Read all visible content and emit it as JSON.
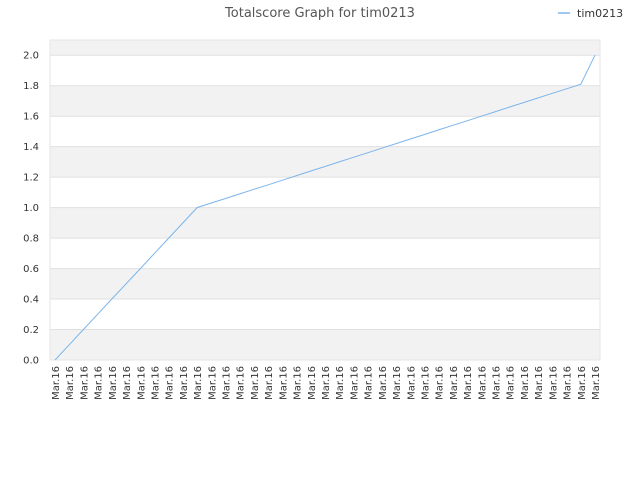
{
  "chart_data": {
    "type": "line",
    "title": "Totalscore Graph for tim0213",
    "xlabel": "",
    "ylabel": "",
    "ylim": [
      0,
      2.1
    ],
    "yticks": [
      "0.0",
      "0.2",
      "0.4",
      "0.6",
      "0.8",
      "1.0",
      "1.2",
      "1.4",
      "1.6",
      "1.8",
      "2.0"
    ],
    "categories": [
      "Mar.16",
      "Mar.16",
      "Mar.16",
      "Mar.16",
      "Mar.16",
      "Mar.16",
      "Mar.16",
      "Mar.16",
      "Mar.16",
      "Mar.16",
      "Mar.16",
      "Mar.16",
      "Mar.16",
      "Mar.16",
      "Mar.16",
      "Mar.16",
      "Mar.16",
      "Mar.16",
      "Mar.16",
      "Mar.16",
      "Mar.16",
      "Mar.16",
      "Mar.16",
      "Mar.16",
      "Mar.16",
      "Mar.16",
      "Mar.16",
      "Mar.16",
      "Mar.16",
      "Mar.16",
      "Mar.16",
      "Mar.16",
      "Mar.16",
      "Mar.16",
      "Mar.16",
      "Mar.16",
      "Mar.16",
      "Mar.16",
      "Mar.16"
    ],
    "series": [
      {
        "name": "tim0213",
        "color": "#7cb5ec",
        "values": [
          0.0,
          0.1,
          0.2,
          0.3,
          0.4,
          0.5,
          0.6,
          0.7,
          0.8,
          0.9,
          1.0,
          1.03,
          1.06,
          1.09,
          1.12,
          1.15,
          1.18,
          1.21,
          1.24,
          1.27,
          1.3,
          1.33,
          1.36,
          1.39,
          1.42,
          1.45,
          1.48,
          1.51,
          1.54,
          1.57,
          1.6,
          1.63,
          1.66,
          1.69,
          1.72,
          1.75,
          1.78,
          1.81,
          2.0
        ]
      }
    ],
    "grid": true,
    "legend_position": "top-right",
    "band_color": "#f2f2f2",
    "grid_color": "#e0e0e0"
  }
}
